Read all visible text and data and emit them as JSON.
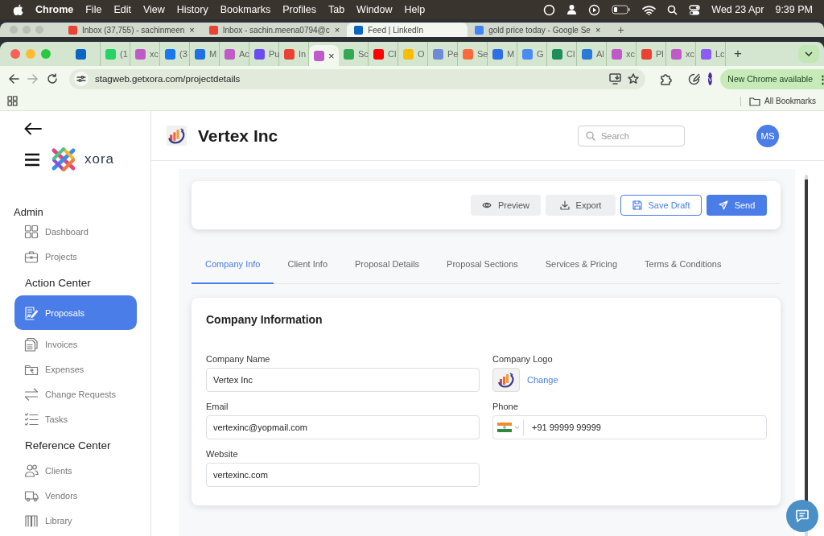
{
  "menubar": {
    "app": "Chrome",
    "menus": [
      "File",
      "Edit",
      "View",
      "History",
      "Bookmarks",
      "Profiles",
      "Tab",
      "Window",
      "Help"
    ],
    "date": "Wed 23 Apr",
    "time": "9:39 PM"
  },
  "background_tabs": [
    {
      "title": "Inbox (37,755) - sachinmeen",
      "selected": false,
      "close": "×",
      "color": "#ea4335"
    },
    {
      "title": "Inbox - sachin.meena0794@c",
      "selected": false,
      "close": "×",
      "color": "#ea4335"
    },
    {
      "title": "Feed | LinkedIn",
      "selected": true,
      "color": "#0a66c2"
    },
    {
      "title": "gold price today - Google Se",
      "selected": false,
      "close": "×",
      "color": "#4285f4"
    }
  ],
  "background_new_tab": "+",
  "tabs": [
    {
      "selected": false,
      "color": "#0a66c2"
    },
    {
      "title": "(1",
      "selected": false,
      "color": "#25d366"
    },
    {
      "title": "xc",
      "selected": false,
      "color": "#c05ac8"
    },
    {
      "title": "(3",
      "selected": false,
      "color": "#1877f2"
    },
    {
      "title": "M",
      "selected": false,
      "color": "#1f6fe5"
    },
    {
      "title": "Ac",
      "selected": false,
      "color": "#c05ac8"
    },
    {
      "title": "Pu",
      "selected": false,
      "color": "#6a4cf0"
    },
    {
      "title": "In",
      "selected": false,
      "color": "#ea4335"
    },
    {
      "selected": true,
      "color": "#c05ac8",
      "close": "×"
    },
    {
      "title": "Sc",
      "selected": false,
      "color": "#34a853"
    },
    {
      "title": "Cl",
      "selected": false,
      "color": "#ff0000"
    },
    {
      "title": "O",
      "selected": false,
      "color": "#fbbc04"
    },
    {
      "title": "Pe",
      "selected": false,
      "color": "#6d8bd6"
    },
    {
      "title": "Se",
      "selected": false,
      "color": "#ff6a3d"
    },
    {
      "title": "M",
      "selected": false,
      "color": "#2e6ee6"
    },
    {
      "title": "G",
      "selected": false,
      "color": "#4a8af4"
    },
    {
      "title": "Cl",
      "selected": false,
      "color": "#1e8e5a"
    },
    {
      "title": "Al",
      "selected": false,
      "color": "#2a7ad8"
    },
    {
      "title": "xc",
      "selected": false,
      "color": "#c05ac8"
    },
    {
      "title": "Pl",
      "selected": false,
      "color": "#ea4335"
    },
    {
      "title": "xc",
      "selected": false,
      "color": "#c05ac8"
    },
    {
      "title": "Lc",
      "selected": false,
      "color": "#8b5cf6"
    }
  ],
  "new_tab": "+",
  "toolbar": {
    "url": "stagweb.getxora.com/projectdetails",
    "profile": "V",
    "update": "New Chrome available",
    "update_menu": "⋮"
  },
  "bookmarks": {
    "all": "All Bookmarks"
  },
  "sidebar": {
    "brand": "xora",
    "sections": [
      {
        "title": "Admin",
        "items": [
          {
            "label": "Dashboard",
            "selected": false
          },
          {
            "label": "Projects",
            "selected": false
          }
        ]
      },
      {
        "title": "Action Center",
        "items": [
          {
            "label": "Proposals",
            "selected": true
          },
          {
            "label": "Invoices",
            "selected": false
          },
          {
            "label": "Expenses",
            "selected": false
          },
          {
            "label": "Change Requests",
            "selected": false
          },
          {
            "label": "Tasks",
            "selected": false
          }
        ]
      },
      {
        "title": "Reference Center",
        "items": [
          {
            "label": "Clients",
            "selected": false
          },
          {
            "label": "Vendors",
            "selected": false
          },
          {
            "label": "Library",
            "selected": false
          }
        ]
      }
    ]
  },
  "header": {
    "title": "Vertex Inc",
    "search_placeholder": "Search",
    "avatar": "MS"
  },
  "actions": [
    {
      "label": "Preview",
      "kind": "secondary"
    },
    {
      "label": "Export",
      "kind": "secondary"
    },
    {
      "label": "Save Draft",
      "kind": "outline"
    },
    {
      "label": "Send",
      "kind": "primary"
    }
  ],
  "section_tabs": [
    {
      "label": "Company Info",
      "selected": true
    },
    {
      "label": "Client Info",
      "selected": false
    },
    {
      "label": "Proposal Details",
      "selected": false
    },
    {
      "label": "Proposal Sections",
      "selected": false
    },
    {
      "label": "Services & Pricing",
      "selected": false
    },
    {
      "label": "Terms & Conditions",
      "selected": false
    }
  ],
  "card": {
    "title": "Company Information",
    "fields": [
      {
        "label": "Company Name",
        "kind": "text",
        "value": "Vertex Inc"
      },
      {
        "label": "Company Logo",
        "kind": "logo",
        "action": "Change"
      },
      {
        "label": "Email",
        "kind": "text",
        "value": "vertexinc@yopmail.com"
      },
      {
        "label": "Phone",
        "kind": "phone",
        "value": "+91 99999 99999"
      },
      {
        "label": "Website",
        "kind": "text",
        "value": "vertexinc.com"
      }
    ]
  }
}
